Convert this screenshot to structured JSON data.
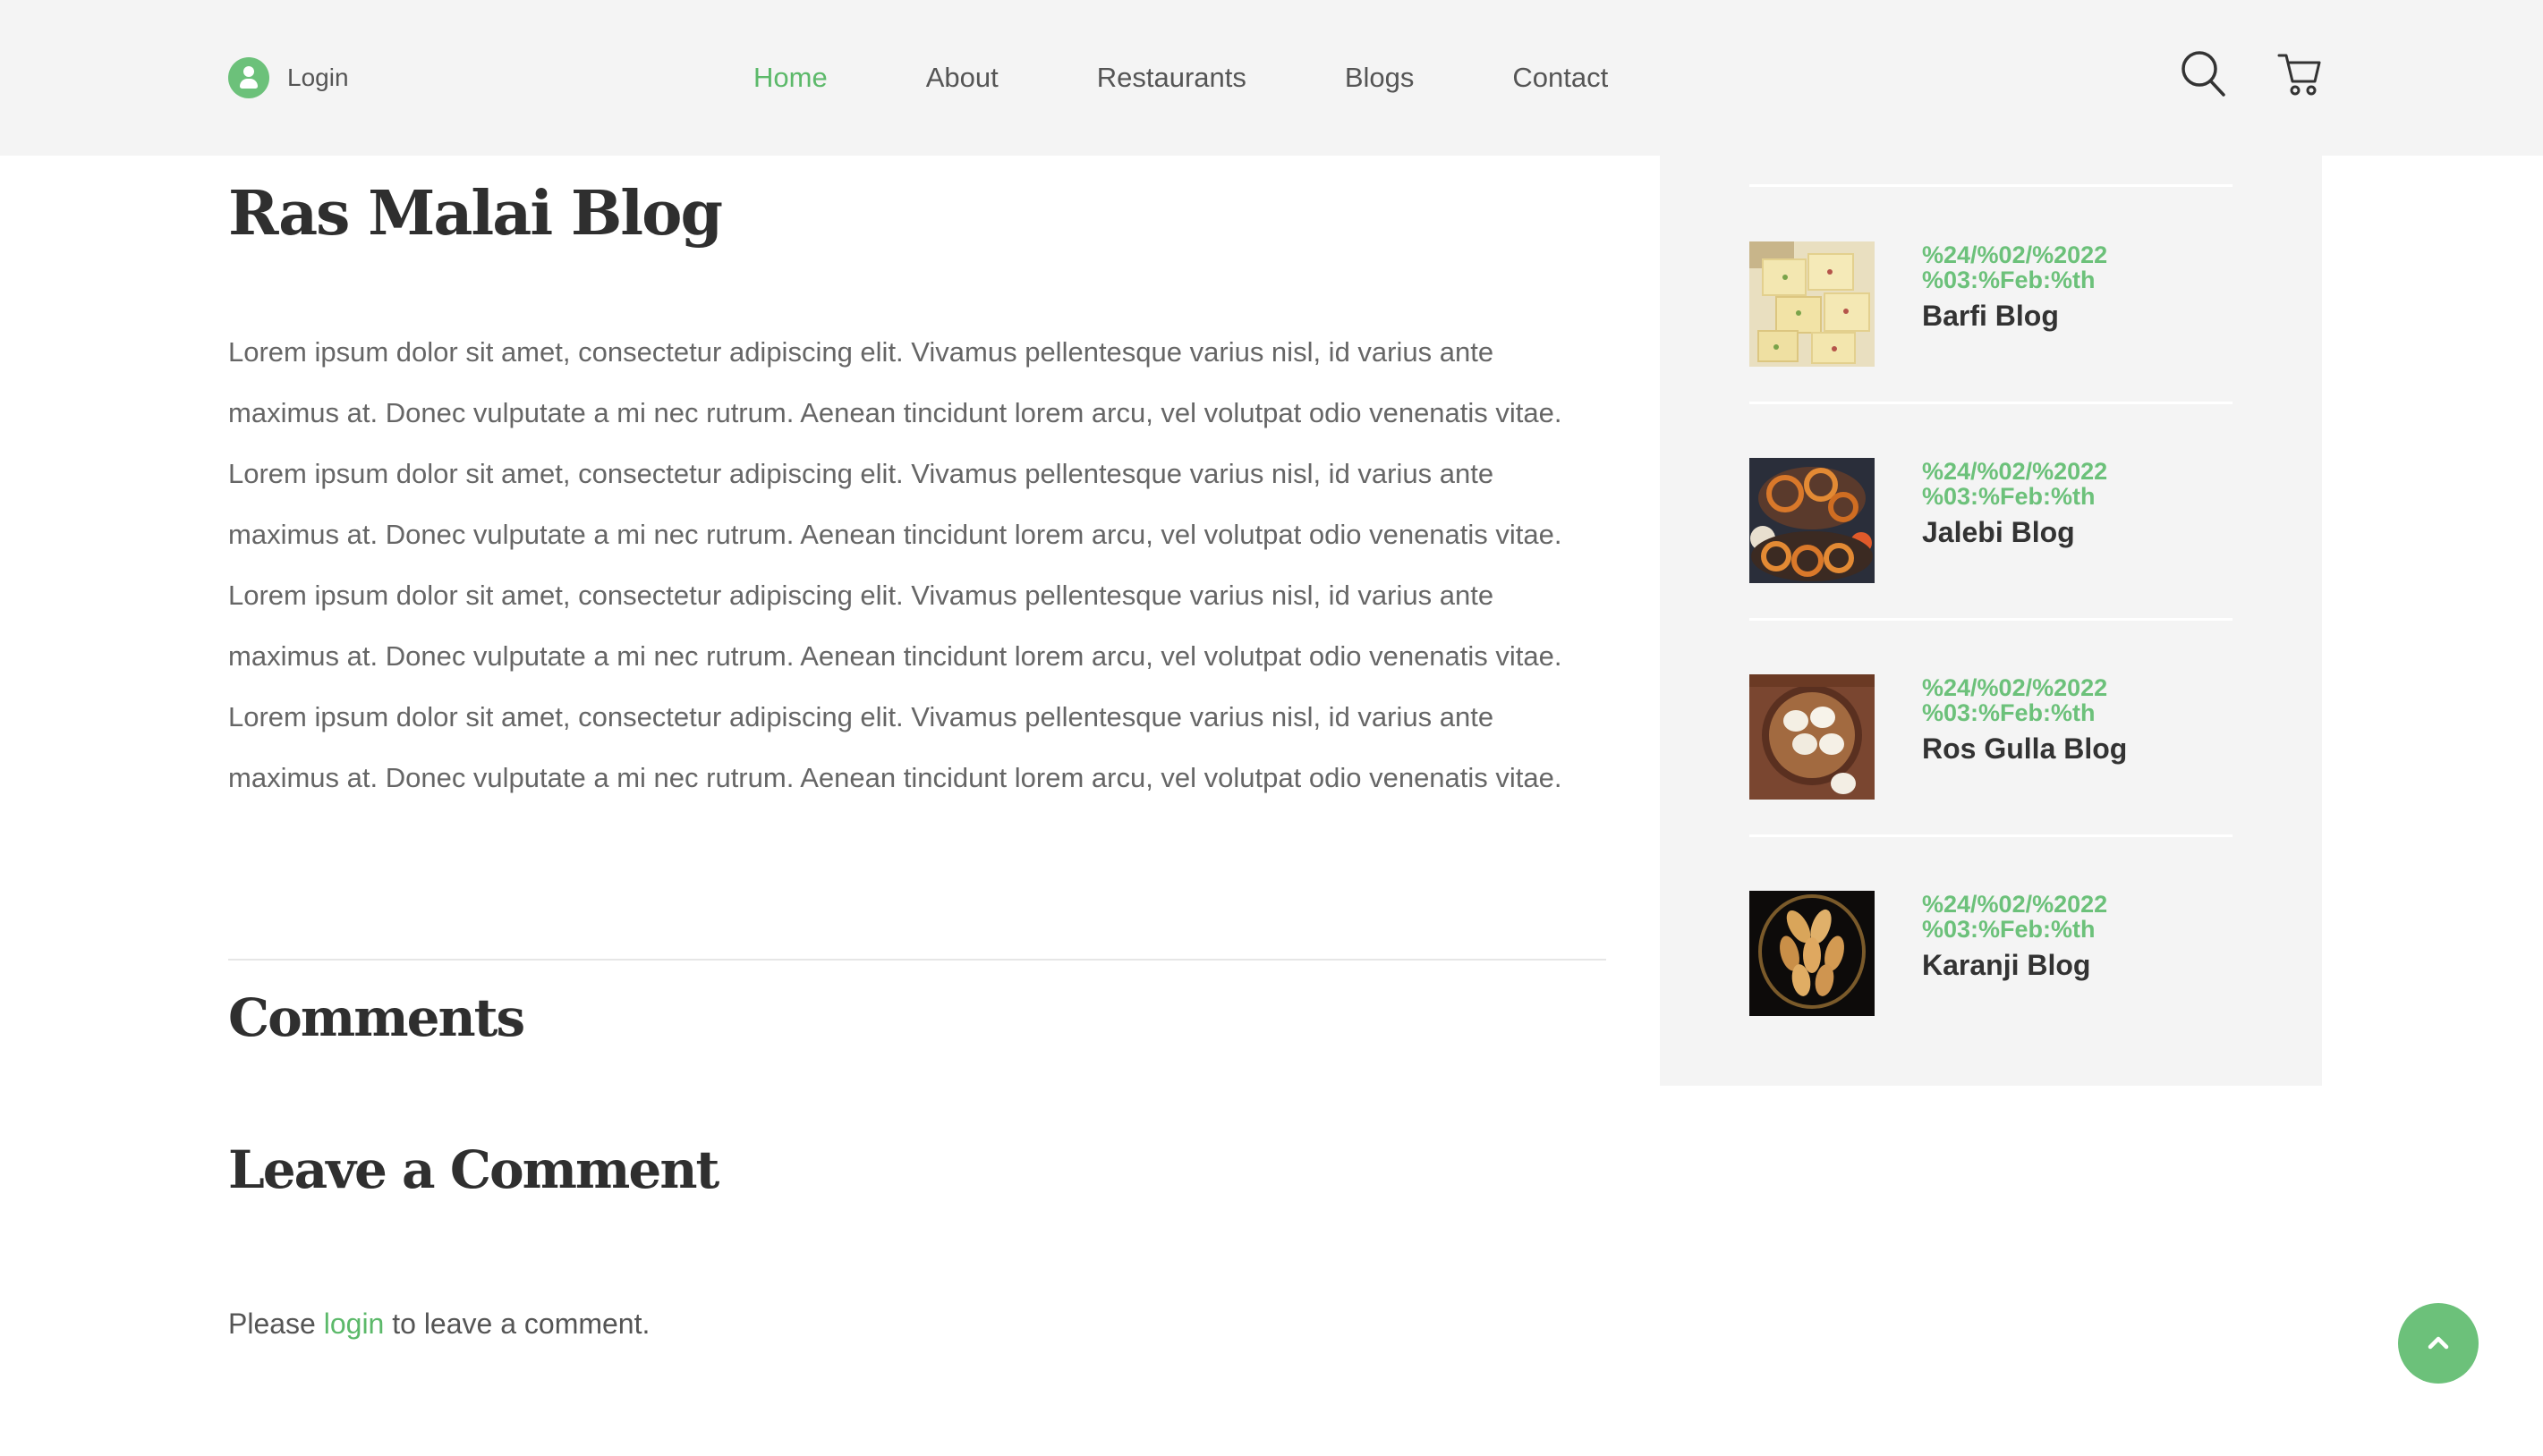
{
  "header": {
    "login_label": "Login",
    "nav": [
      "Home",
      "About",
      "Restaurants",
      "Blogs",
      "Contact"
    ],
    "active_nav": "Home",
    "icons": [
      "user-icon",
      "search-icon",
      "cart-icon"
    ]
  },
  "article": {
    "title": "Ras Malai Blog",
    "body": "Lorem ipsum dolor sit amet, consectetur adipiscing elit. Vivamus pellentesque varius nisl, id varius ante maximus at. Donec vulputate a mi nec rutrum. Aenean tincidunt lorem arcu, vel volutpat odio venenatis vitae. Lorem ipsum dolor sit amet, consectetur adipiscing elit. Vivamus pellentesque varius nisl, id varius ante maximus at. Donec vulputate a mi nec rutrum. Aenean tincidunt lorem arcu, vel volutpat odio venenatis vitae. Lorem ipsum dolor sit amet, consectetur adipiscing elit. Vivamus pellentesque varius nisl, id varius ante maximus at. Donec vulputate a mi nec rutrum. Aenean tincidunt lorem arcu, vel volutpat odio venenatis vitae. Lorem ipsum dolor sit amet, consectetur adipiscing elit. Vivamus pellentesque varius nisl, id varius ante maximus at. Donec vulputate a mi nec rutrum. Aenean tincidunt lorem arcu, vel volutpat odio venenatis vitae.",
    "comments_title": "Comments",
    "leave_comment_title": "Leave a Comment",
    "login_note_prefix": "Please ",
    "login_note_link": "login",
    "login_note_suffix": " to leave a comment."
  },
  "sidebar": {
    "posts": [
      {
        "date": "%24/%02/%2022 %03:%Feb:%th",
        "title": "Barfi Blog",
        "image": "barfi-thumbnail"
      },
      {
        "date": "%24/%02/%2022 %03:%Feb:%th",
        "title": "Jalebi Blog",
        "image": "jalebi-thumbnail"
      },
      {
        "date": "%24/%02/%2022 %03:%Feb:%th",
        "title": "Ros Gulla Blog",
        "image": "ros-gulla-thumbnail"
      },
      {
        "date": "%24/%02/%2022 %03:%Feb:%th",
        "title": "Karanji Blog",
        "image": "karanji-thumbnail"
      }
    ]
  },
  "colors": {
    "accent": "#5cb96a",
    "header_bg": "#f4f4f4",
    "sidebar_bg": "#f4f4f4",
    "heading": "#2f2f2f",
    "body_text": "#666666"
  },
  "back_to_top_icon": "chevron-up-icon"
}
